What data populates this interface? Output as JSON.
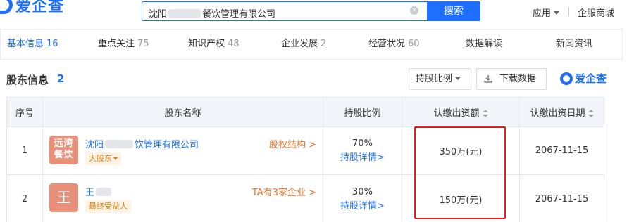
{
  "brand": {
    "logo_text": "爱企查",
    "accent": "#1e6fff"
  },
  "search": {
    "value_prefix": "沈阳",
    "value_suffix": "餐饮管理有限公司",
    "clear_icon": "close-circle-icon",
    "button_label": "搜索"
  },
  "top_nav": {
    "apps_label": "应用",
    "mall_label": "企服商城"
  },
  "tabs": [
    {
      "label": "基本信息",
      "count": "16",
      "active": true
    },
    {
      "label": "重点关注",
      "count": "75"
    },
    {
      "label": "知识产权",
      "count": "48"
    },
    {
      "label": "企业发展",
      "count": "2"
    },
    {
      "label": "经营状况",
      "count": "60"
    },
    {
      "label": "数据解读",
      "count": ""
    },
    {
      "label": "新闻资讯",
      "count": ""
    }
  ],
  "section": {
    "title": "股东信息",
    "count": "2",
    "ratio_button": "持股比例",
    "download_button": "下载数据",
    "watermark": "爱企查"
  },
  "table": {
    "headers": [
      "序号",
      "股东名称",
      "持股比例",
      "认缴出资额",
      "认缴出资日期"
    ],
    "rows": [
      {
        "index": "1",
        "avatar_line1": "远湾",
        "avatar_line2": "餐饮",
        "name_prefix": "沈阳",
        "name_suffix": "饮管理有限公司",
        "tag": "大股东",
        "link": "股权结构 >",
        "ratio": "70%",
        "detail": "持股详情>",
        "amount": "350万(元)",
        "date": "2067-11-15"
      },
      {
        "index": "2",
        "avatar_char": "王",
        "name_prefix": "王",
        "name_suffix": "",
        "tag": "最终受益人",
        "link": "TA有3家企业 >",
        "ratio": "30%",
        "detail": "持股详情>",
        "amount": "150万(元)",
        "date": "2067-11-15"
      }
    ]
  },
  "colors": {
    "highlight_box": "#e01e1e",
    "link_orange": "#e1762e",
    "avatar_bg": "#e8907a"
  }
}
